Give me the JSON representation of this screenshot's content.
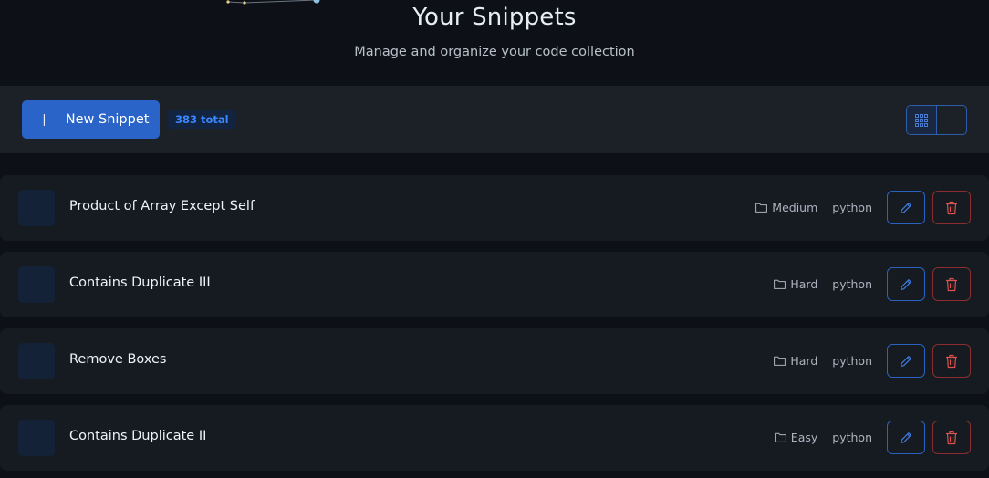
{
  "header": {
    "title": "Your Snippets",
    "subtitle": "Manage and organize your code collection"
  },
  "toolbar": {
    "new_label": "New Snippet",
    "total_badge": "383 total",
    "view_modes": [
      "grid-view",
      "list-view"
    ],
    "active_view": "list-view"
  },
  "snippets": [
    {
      "title": "Product of Array Except Self",
      "category": "Medium",
      "language": "python"
    },
    {
      "title": "Contains Duplicate III",
      "category": "Hard",
      "language": "python"
    },
    {
      "title": "Remove Boxes",
      "category": "Hard",
      "language": "python"
    },
    {
      "title": "Contains Duplicate II",
      "category": "Easy",
      "language": "python"
    }
  ],
  "colors": {
    "background": "#0d1117",
    "primary": "#2a64c8",
    "danger": "#d9534f",
    "badge_text": "#3a86ff"
  },
  "icons": {
    "new": "plus-icon",
    "grid": "grid-icon",
    "list": "list-icon",
    "folder": "folder-icon",
    "edit": "pencil-icon",
    "delete": "trash-icon"
  }
}
